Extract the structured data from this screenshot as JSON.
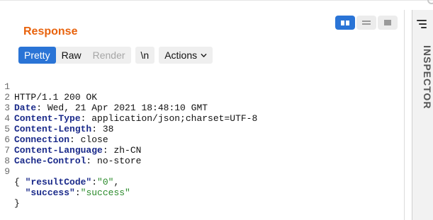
{
  "panel": {
    "title": "Response"
  },
  "view_mode": {
    "options": [
      "split",
      "horizontal",
      "single"
    ],
    "selected": "split"
  },
  "toolbar": {
    "pretty_label": "Pretty",
    "raw_label": "Raw",
    "render_label": "Render",
    "newline_label": "\\n",
    "actions_label": "Actions",
    "selected_tab": "Pretty"
  },
  "sidebar": {
    "inspector_label": "INSPECTOR",
    "menu_icon": "hamburger-icon"
  },
  "editor": {
    "line_numbers": [
      "1",
      "2",
      "3",
      "4",
      "5",
      "6",
      "7",
      "8",
      "9"
    ],
    "status_line": "HTTP/1.1 200 OK",
    "headers": [
      {
        "name": "Date",
        "value": "Wed, 21 Apr 2021 18:48:10 GMT"
      },
      {
        "name": "Content-Type",
        "value": "application/json;charset=UTF-8"
      },
      {
        "name": "Content-Length",
        "value": "38"
      },
      {
        "name": "Connection",
        "value": "close"
      },
      {
        "name": "Content-Language",
        "value": "zh-CN"
      },
      {
        "name": "Cache-Control",
        "value": "no-store"
      }
    ],
    "separator": ": ",
    "body_open": "{",
    "body_close": "}",
    "body_entries": [
      {
        "key": "\"resultCode\"",
        "colon": ":",
        "value": "\"0\"",
        "trail": ","
      },
      {
        "key": "\"success\"",
        "colon": ":",
        "value": "\"success\"",
        "trail": ""
      }
    ]
  },
  "colors": {
    "title": "#e8620c",
    "accent": "#2a74d6",
    "header_key": "#1a2a8a",
    "json_string": "#2a8a2a"
  }
}
